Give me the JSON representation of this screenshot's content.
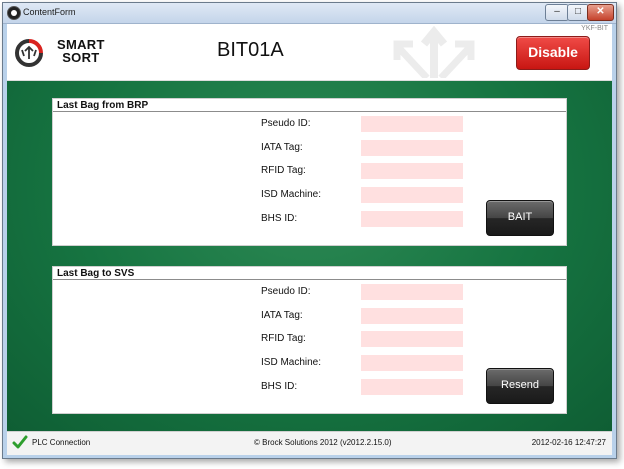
{
  "window": {
    "title": "ContentForm",
    "minimize_glyph": "–",
    "maximize_glyph": "□",
    "close_glyph": "✕"
  },
  "header": {
    "corner_id": "YKF-BIT",
    "logo_line1": "SMART",
    "logo_line2": "SORT",
    "station_name": "BIT01A",
    "disable_label": "Disable"
  },
  "panels": [
    {
      "title": "Last Bag from BRP",
      "fields": [
        {
          "label": "Pseudo ID:",
          "value": ""
        },
        {
          "label": "IATA Tag:",
          "value": ""
        },
        {
          "label": "RFID Tag:",
          "value": ""
        },
        {
          "label": "ISD Machine:",
          "value": ""
        },
        {
          "label": "BHS ID:",
          "value": ""
        }
      ],
      "button_label": "BAIT"
    },
    {
      "title": "Last Bag to SVS",
      "fields": [
        {
          "label": "Pseudo ID:",
          "value": ""
        },
        {
          "label": "IATA Tag:",
          "value": ""
        },
        {
          "label": "RFID Tag:",
          "value": ""
        },
        {
          "label": "ISD Machine:",
          "value": ""
        },
        {
          "label": "BHS ID:",
          "value": ""
        }
      ],
      "button_label": "Resend"
    }
  ],
  "footer": {
    "status_icon": "check-icon",
    "plc_label": "PLC Connection",
    "copyright": "© Brock Solutions 2012 (v2012.2.15.0)",
    "datetime": "2012-02-16 12:47:27"
  },
  "colors": {
    "green_background": "#167441",
    "disable_red": "#d9231f",
    "field_background": "#ffe0e0",
    "check_green": "#2e9e2e"
  }
}
